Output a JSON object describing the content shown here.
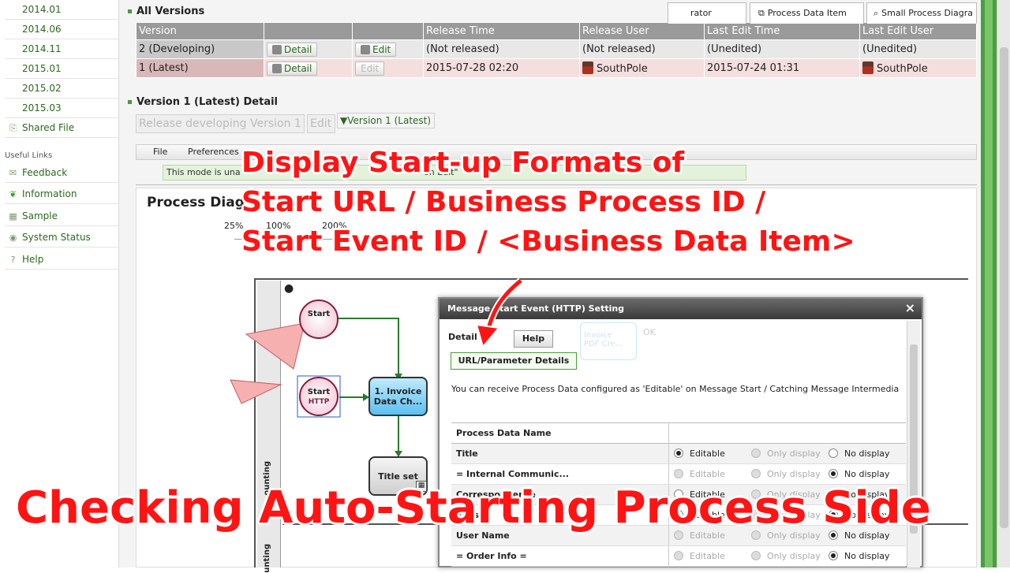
{
  "sidebar": {
    "archive_items": [
      "2014.01",
      "2014.06",
      "2014.11",
      "2015.01",
      "2015.02",
      "2015.03"
    ],
    "shared_file": "Shared File",
    "useful_links_heading": "Useful Links",
    "links": [
      "Feedback",
      "Information",
      "Sample",
      "System Status",
      "Help"
    ]
  },
  "all_versions": {
    "title": "All Versions",
    "headers": [
      "Version",
      "",
      "",
      "Release Time",
      "Release User",
      "Last Edit Time",
      "Last Edit User"
    ],
    "rows": [
      {
        "version": "2 (Developing)",
        "detail": "Detail",
        "edit": "Edit",
        "release_time": "(Not released)",
        "release_user": "(Not released)",
        "last_edit_time": "(Unedited)",
        "last_edit_user": "(Unedited)"
      },
      {
        "version": "1 (Latest)",
        "detail": "Detail",
        "edit": "Edit",
        "release_time": "2015-07-28 02:20",
        "release_user": "SouthPole",
        "last_edit_time": "2015-07-24 01:31",
        "last_edit_user": "SouthPole"
      }
    ]
  },
  "version_detail": {
    "title": "Version 1 (Latest) Detail",
    "release_button": "Release developing Version 1",
    "edit_button": "Edit",
    "version_select": "▼Version 1 (Latest)"
  },
  "menu": {
    "file": "File",
    "preferences": "Preferences"
  },
  "mode_notice": "This mode is una",
  "mode_notice_tail": "on Edit\"",
  "tabs": {
    "operator": "rator",
    "process_data_item": "Process Data Item",
    "small_diagram": "Small Process Diagra"
  },
  "diagram": {
    "title": "Process Diag",
    "zoom_levels": [
      "25%",
      "100%",
      "200%"
    ],
    "start_label": "Start",
    "start_http_label": "Start",
    "start_http_sub": "HTTP",
    "task_invoice": "1. Invoice Data Ch...",
    "task_title": "Title set",
    "lane_label": "ounting",
    "lane_label2": "unting",
    "bg_task": "PDF Cre...",
    "bg_ok": "OK",
    "bg_invoice": "Invoice"
  },
  "dialog": {
    "title": "Message Start Event (HTTP) Setting",
    "close": "×",
    "detail_label": "Detail",
    "help_button": "Help",
    "url_button": "URL/Parameter Details",
    "description": "You can receive Process Data configured as 'Editable' on Message Start / Catching Message Intermedia",
    "column_header": "Process Data Name",
    "options": [
      "Editable",
      "Only display",
      "No display"
    ],
    "rows": [
      {
        "name": "Title",
        "selected": 0,
        "disabled": false
      },
      {
        "name": "= Internal Communic...",
        "selected": 2,
        "disabled": true
      },
      {
        "name": "Correspondence",
        "selected": 2,
        "disabled": false
      },
      {
        "name": "Files",
        "selected": 2,
        "disabled": false
      },
      {
        "name": "User Name",
        "selected": 2,
        "disabled": true
      },
      {
        "name": "= Order Info =",
        "selected": 2,
        "disabled": true
      }
    ]
  },
  "overlay": {
    "line1": "Display Start-up Formats of",
    "line2": "Start URL / Business Process ID /",
    "line3": "Start Event ID / <Business Data Item>",
    "caption": "Checking Auto-Starting Process Side"
  },
  "colors": {
    "accent": "#ff1414",
    "sidebar_green": "#4aa03c",
    "link_green": "#2a6a1c"
  }
}
